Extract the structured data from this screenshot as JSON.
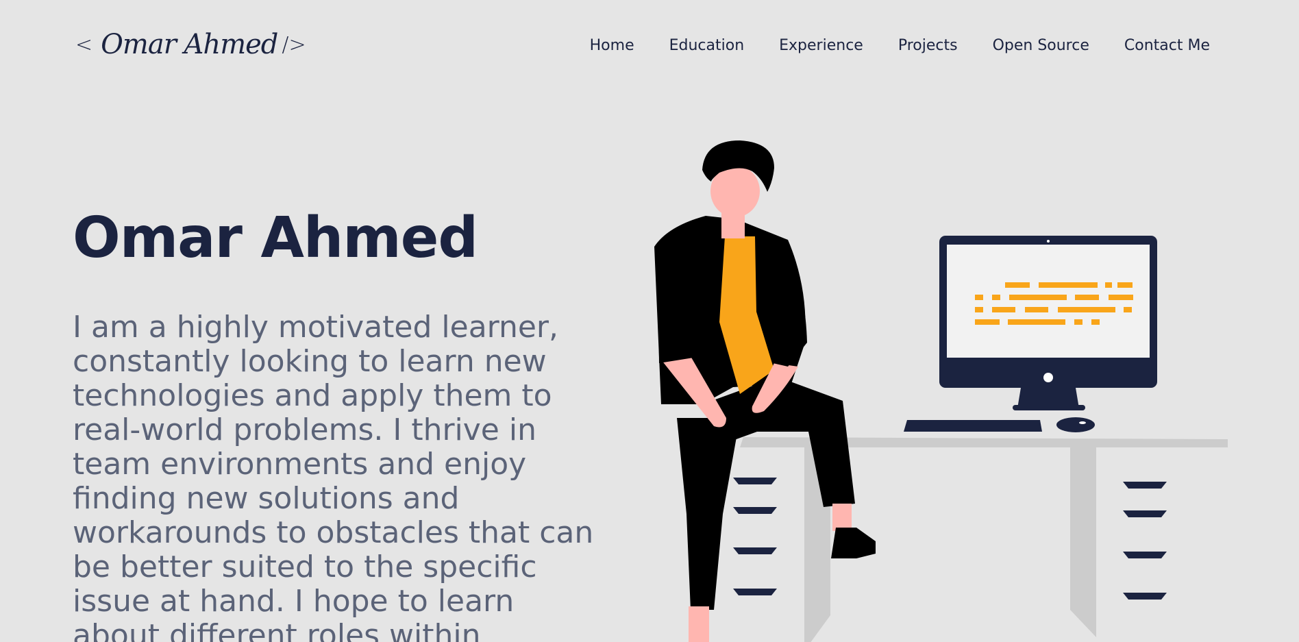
{
  "header": {
    "logo": {
      "open_bracket": "<",
      "signature": "Omar Ahmed",
      "close_bracket": "/>"
    },
    "nav": [
      {
        "label": "Home"
      },
      {
        "label": "Education"
      },
      {
        "label": "Experience"
      },
      {
        "label": "Projects"
      },
      {
        "label": "Open Source"
      },
      {
        "label": "Contact Me"
      }
    ]
  },
  "hero": {
    "title": "Omar Ahmed",
    "description": "I am a highly motivated learner, constantly looking to learn new technologies and apply them to real-world problems. I thrive in team environments and enjoy finding new solutions and workarounds to obstacles that can be better suited to the specific issue at hand. I hope to learn about different roles within",
    "illustration_icon": "developer-at-desk-illustration"
  },
  "colors": {
    "background": "#e5e5e5",
    "primary": "#1b2340",
    "text_muted": "#5b6378",
    "accent": "#f9a51a",
    "skin": "#ffb6b0",
    "desk": "#cccccc"
  }
}
